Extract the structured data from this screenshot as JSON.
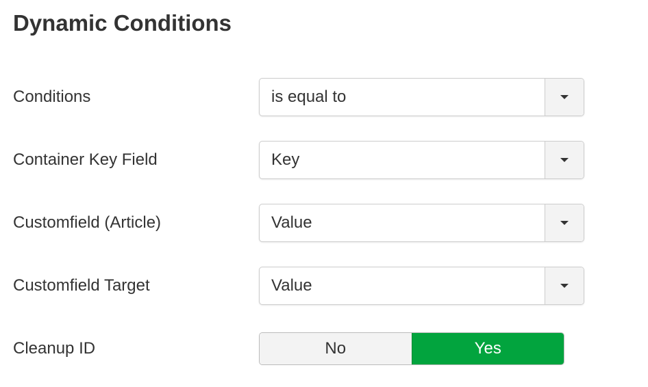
{
  "title": "Dynamic Conditions",
  "fields": [
    {
      "label": "Conditions",
      "value": "is equal to",
      "icon": "caret-down-icon"
    },
    {
      "label": "Container Key Field",
      "value": "Key",
      "icon": "caret-down-icon"
    },
    {
      "label": "Customfield (Article)",
      "value": "Value",
      "icon": "caret-down-icon"
    },
    {
      "label": "Customfield Target",
      "value": "Value",
      "icon": "caret-down-icon"
    }
  ],
  "cleanup": {
    "label": "Cleanup ID",
    "options": [
      "No",
      "Yes"
    ],
    "selected": "Yes"
  },
  "colors": {
    "active_toggle": "#02a43e",
    "text": "#333333",
    "border": "#cccccc",
    "button_bg": "#f3f3f3"
  }
}
